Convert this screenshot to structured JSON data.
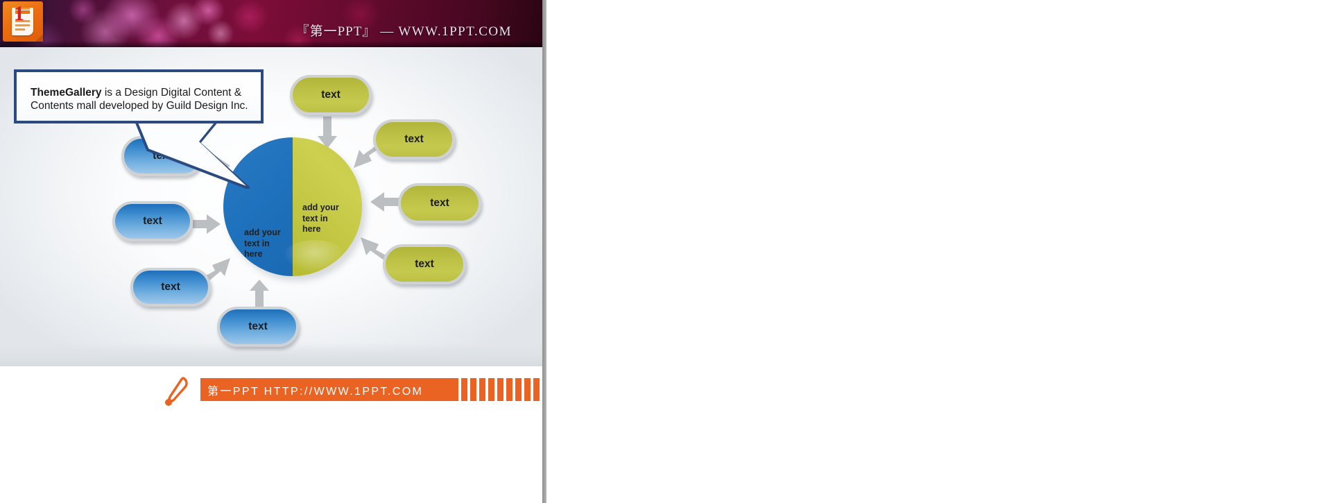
{
  "header": {
    "logo_numeral": "1",
    "title_brand": "『第一PPT』",
    "title_separator": "—",
    "title_url": "WWW.1PPT.COM"
  },
  "callout": {
    "bold_lead": "ThemeGallery",
    "body": " is a Design Digital Content & Contents mall developed by Guild Design Inc."
  },
  "diagram": {
    "pie": {
      "left_label": "add your\ntext in\nhere",
      "right_label": "add your\ntext in\nhere",
      "left_color": "#1f72bd",
      "right_color": "#c3c743"
    },
    "blue_pills": [
      {
        "label": "text"
      },
      {
        "label": "text"
      },
      {
        "label": "text"
      },
      {
        "label": "text"
      }
    ],
    "olive_pills": [
      {
        "label": "text"
      },
      {
        "label": "text"
      },
      {
        "label": "text"
      },
      {
        "label": "text"
      }
    ],
    "arrow_color": "#b9bcbf"
  },
  "footer": {
    "bar_text": "第一PPT HTTP://WWW.1PPT.COM",
    "bar_color": "#ea6322"
  },
  "chart_data": {
    "type": "pie",
    "title": "",
    "categories": [
      "add your text in here",
      "add your text in here"
    ],
    "values": [
      50,
      50
    ],
    "colors": [
      "#1f72bd",
      "#c3c743"
    ],
    "legend": "none"
  }
}
